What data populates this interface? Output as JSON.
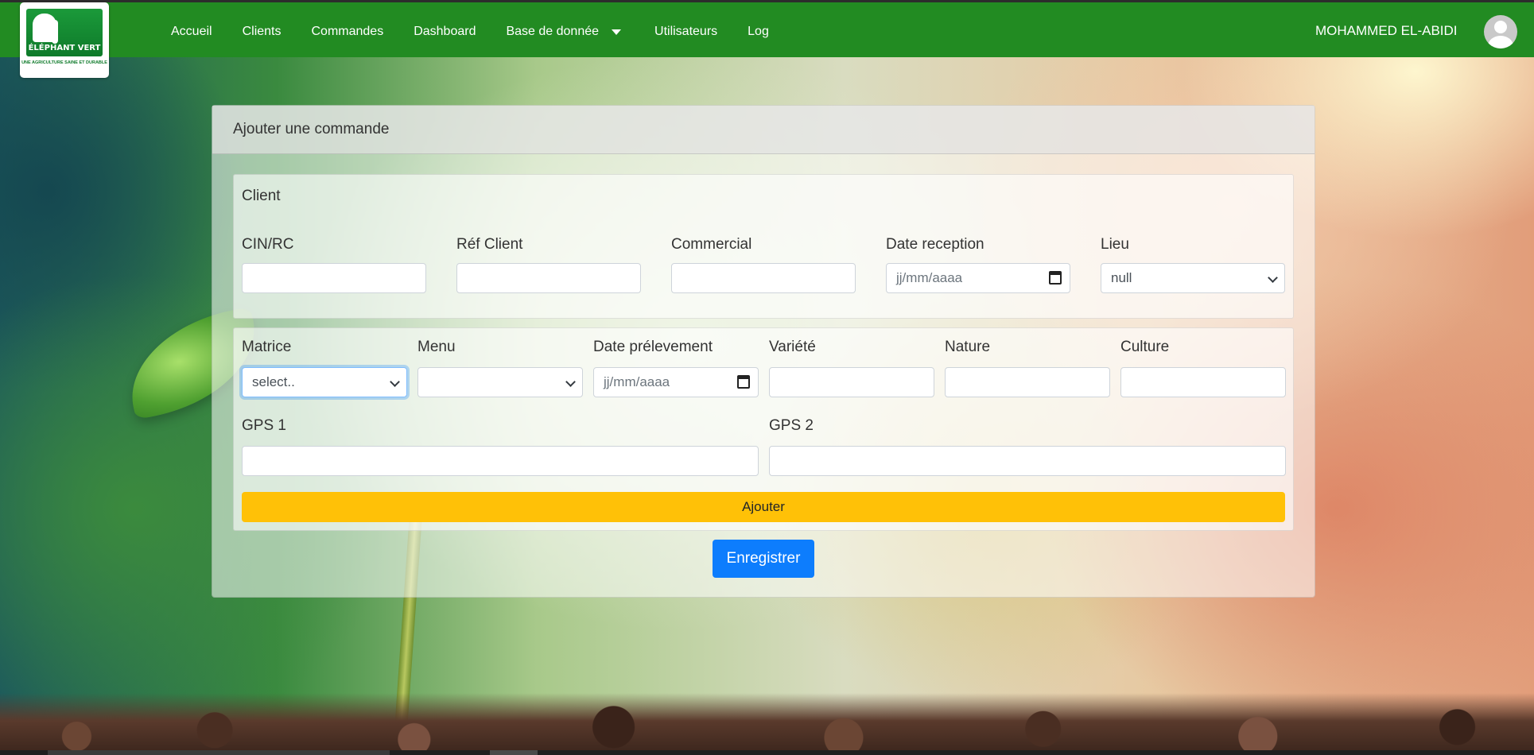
{
  "brand": {
    "name": "ÉLÉPHANT VERT",
    "tagline": "UNE AGRICULTURE SAINE ET DURABLE"
  },
  "nav": {
    "items": [
      {
        "label": "Accueil"
      },
      {
        "label": "Clients"
      },
      {
        "label": "Commandes"
      },
      {
        "label": "Dashboard"
      },
      {
        "label": "Base de donnée"
      },
      {
        "label": "Utilisateurs"
      },
      {
        "label": "Log"
      }
    ],
    "user_name": "MOHAMMED EL-ABIDI"
  },
  "card": {
    "title": "Ajouter une commande",
    "client_section": {
      "title": "Client",
      "fields": {
        "cin_rc": {
          "label": "CIN/RC",
          "value": ""
        },
        "ref_client": {
          "label": "Réf Client",
          "value": ""
        },
        "commercial": {
          "label": "Commercial",
          "value": ""
        },
        "date_reception": {
          "label": "Date reception",
          "placeholder": "jj/mm/aaaa"
        },
        "lieu": {
          "label": "Lieu",
          "selected": "null"
        }
      }
    },
    "sample_section": {
      "fields": {
        "matrice": {
          "label": "Matrice",
          "selected": "select.."
        },
        "menu": {
          "label": "Menu",
          "selected": ""
        },
        "date_prelevement": {
          "label": "Date prélevement",
          "placeholder": "jj/mm/aaaa"
        },
        "variete": {
          "label": "Variété",
          "value": ""
        },
        "nature": {
          "label": "Nature",
          "value": ""
        },
        "culture": {
          "label": "Culture",
          "value": ""
        },
        "gps1": {
          "label": "GPS 1",
          "value": ""
        },
        "gps2": {
          "label": "GPS 2",
          "value": ""
        }
      },
      "add_button": "Ajouter"
    },
    "save_button": "Enregistrer"
  },
  "colors": {
    "navbar": "#228b22",
    "add_button": "#ffc107",
    "save_button": "#0d7dfd"
  }
}
